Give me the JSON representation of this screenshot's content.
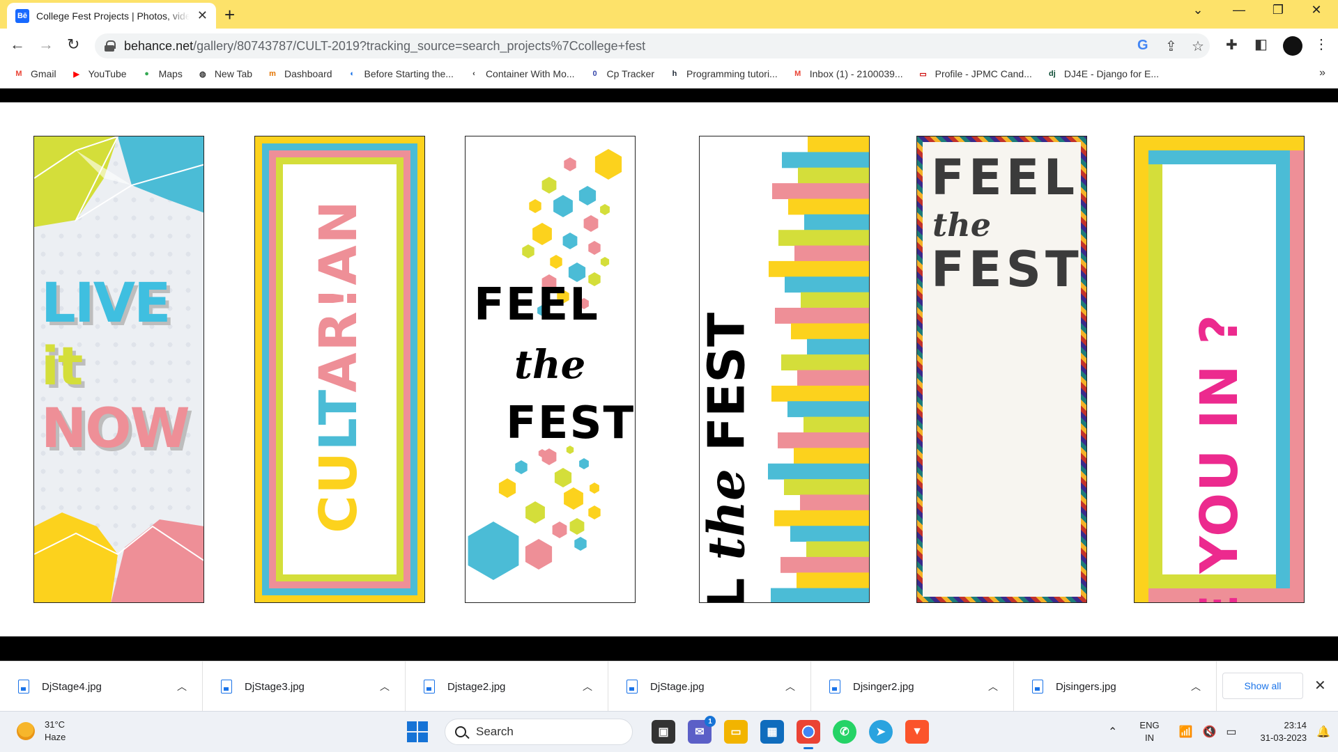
{
  "browser": {
    "tab_title": "College Fest Projects | Photos, videos",
    "tab_favicon": "Bē",
    "url_host": "behance.net",
    "url_path": "/gallery/80743787/CULT-2019?tracking_source=search_projects%7Ccollege+fest"
  },
  "bookmarks": [
    {
      "label": "Gmail",
      "icon": "gmail-icon",
      "glyph": "M",
      "color": "#ea4335"
    },
    {
      "label": "YouTube",
      "icon": "youtube-icon",
      "glyph": "▶",
      "color": "#ff0000"
    },
    {
      "label": "Maps",
      "icon": "maps-icon",
      "glyph": "●",
      "color": "#34a853"
    },
    {
      "label": "New Tab",
      "icon": "globe-icon",
      "glyph": "◍",
      "color": "#333333"
    },
    {
      "label": "Dashboard",
      "icon": "dashboard-icon",
      "glyph": "m",
      "color": "#e37400"
    },
    {
      "label": "Before Starting the...",
      "icon": "link-icon",
      "glyph": "◐",
      "color": "#1a73e8"
    },
    {
      "label": "Container With Mo...",
      "icon": "leetcode-icon",
      "glyph": "‹",
      "color": "#333333"
    },
    {
      "label": "Cp Tracker",
      "icon": "cptracker-icon",
      "glyph": "0",
      "color": "#3949ab"
    },
    {
      "label": "Programming tutori...",
      "icon": "hackerrank-icon",
      "glyph": "h",
      "color": "#1f2937"
    },
    {
      "label": "Inbox (1) - 2100039...",
      "icon": "gmail-icon",
      "glyph": "M",
      "color": "#ea4335"
    },
    {
      "label": "Profile - JPMC Cand...",
      "icon": "profile-icon",
      "glyph": "▭",
      "color": "#cc0000"
    },
    {
      "label": "DJ4E - Django for E...",
      "icon": "django-icon",
      "glyph": "dj",
      "color": "#0c4b33"
    }
  ],
  "banners": {
    "b1": {
      "line1": "LIVE",
      "line2": "it",
      "line3": "NOW"
    },
    "b2": {
      "word": "CULTAR!AN"
    },
    "b3": {
      "line1": "FEEL",
      "line2": "the",
      "line3": "FEST"
    },
    "b4": {
      "word1": "FEEL ",
      "word2": "the",
      "word3": " FEST"
    },
    "b5": {
      "line1": "FEEL",
      "line2": "the",
      "line3": "FEST"
    },
    "b6": {
      "word": "ARE YOU IN ?"
    }
  },
  "colors": {
    "yellow": "#fcd21d",
    "blue": "#4bbcd6",
    "pink": "#ee8f97",
    "lime": "#d4de3a",
    "magenta": "#ec2a8e",
    "tabstrip": "#fde26a"
  },
  "downloads": {
    "items": [
      "DjStage4.jpg",
      "DjStage3.jpg",
      "Djstage2.jpg",
      "DjStage.jpg",
      "Djsinger2.jpg",
      "Djsingers.jpg"
    ],
    "show_all": "Show all"
  },
  "taskbar": {
    "temperature": "31°C",
    "weather": "Haze",
    "search_placeholder": "Search",
    "chat_badge": "1",
    "lang_line1": "ENG",
    "lang_line2": "IN",
    "time": "23:14",
    "date": "31-03-2023"
  }
}
